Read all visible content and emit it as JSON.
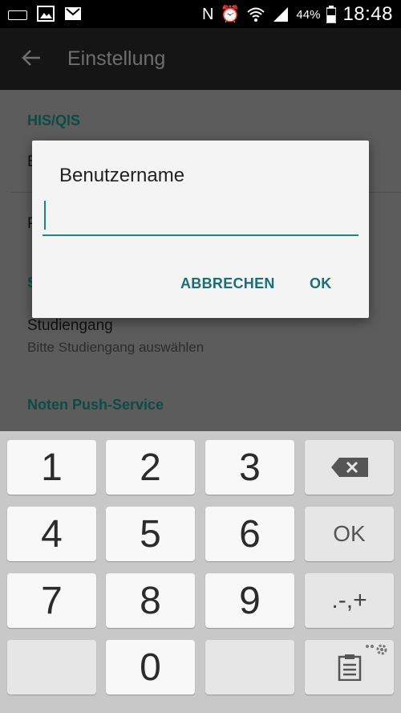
{
  "status_bar": {
    "icons": [
      "keyboard-icon",
      "image-icon",
      "gmail-icon",
      "nfc-icon",
      "alarm-icon",
      "wifi-icon",
      "signal-icon",
      "battery-icon"
    ],
    "nfc_glyph": "N",
    "alarm_glyph": "⏰",
    "wifi_glyph": "◠",
    "signal_glyph": "◢",
    "battery": "44%",
    "time": "18:48"
  },
  "app_bar": {
    "title": "Einstellung"
  },
  "settings": {
    "section1": "HIS/QIS",
    "row1_partial": "B",
    "row2_partial": "P",
    "section2_partial": "S",
    "course_title": "Studiengang",
    "course_subtitle": "Bitte Studiengang auswählen",
    "section3": "Noten Push-Service"
  },
  "dialog": {
    "title": "Benutzername",
    "input_value": "",
    "cancel_label": "ABBRECHEN",
    "ok_label": "OK"
  },
  "keyboard": {
    "k1": "1",
    "k2": "2",
    "k3": "3",
    "k4": "4",
    "k5": "5",
    "k6": "6",
    "k7": "7",
    "k8": "8",
    "k9": "9",
    "k0": "0",
    "ok": "OK",
    "symbols": ".-,+",
    "backspace_icon": "backspace-icon",
    "clipboard_icon": "clipboard-icon"
  },
  "colors": {
    "accent": "#1a8a7e",
    "dialog_button": "#1a6e76",
    "section_header": "#0d4c45"
  }
}
